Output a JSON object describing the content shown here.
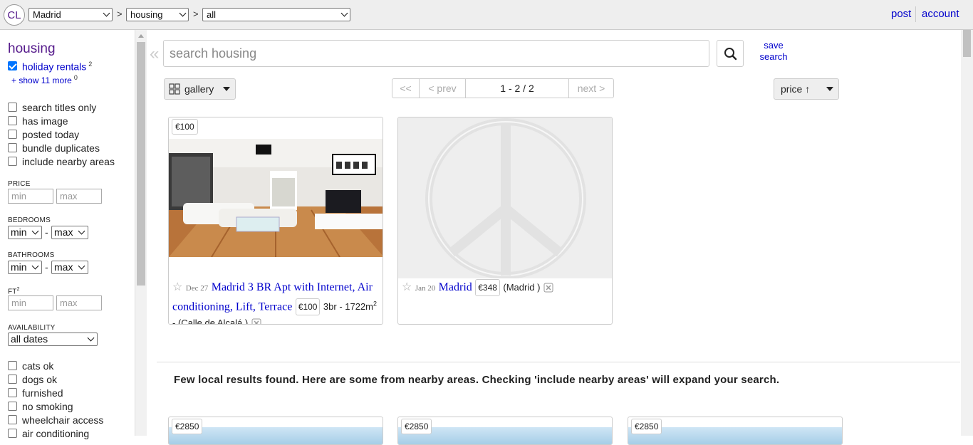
{
  "header": {
    "logo_text": "CL",
    "city_select": "Madrid",
    "crumb_sep": ">",
    "category_select": "housing",
    "subcategory_select": "all",
    "post_link": "post",
    "account_link": "account"
  },
  "sidebar": {
    "title": "housing",
    "category": {
      "label": "holiday rentals",
      "count": "2",
      "checked": true
    },
    "show_more": {
      "label": "show 11 more",
      "count": "0"
    },
    "search_options": [
      "search titles only",
      "has image",
      "posted today",
      "bundle duplicates",
      "include nearby areas"
    ],
    "price_label": "PRICE",
    "min_placeholder": "min",
    "max_placeholder": "max",
    "bedrooms_label": "BEDROOMS",
    "bathrooms_label": "BATHROOMS",
    "range_min": "min",
    "range_max": "max",
    "range_dash": "-",
    "ft_label": "FT",
    "ft_sup": "2",
    "availability_label": "AVAILABILITY",
    "availability_value": "all dates",
    "amenities": [
      "cats ok",
      "dogs ok",
      "furnished",
      "no smoking",
      "wheelchair access",
      "air conditioning"
    ]
  },
  "search": {
    "collapse_glyph": "«",
    "placeholder": "search housing",
    "save_label_1": "save",
    "save_label_2": "search"
  },
  "toolbar": {
    "view_label": "gallery",
    "pager_first": "<<",
    "pager_prev": "< prev",
    "pager_range": "1 - 2 / 2",
    "pager_next": "next >",
    "sort_label": "price ↑"
  },
  "listings": [
    {
      "price": "€100",
      "date": "Dec 27",
      "title": "Madrid 3 BR Apt with Internet, Air conditioning, Lift, Terrace",
      "inline_price": "€100",
      "details": "3br - 1722m",
      "details_sup": "2",
      "location": "- (Calle de Alcalá )"
    },
    {
      "date": "Jan 20",
      "title": "Madrid",
      "inline_price": "€348",
      "location": "(Madrid )"
    }
  ],
  "nearby_note": "Few local results found. Here are some from nearby areas. Checking 'include nearby areas' will expand your search.",
  "nearby_prices": [
    "€2850",
    "€2850",
    "€2850"
  ]
}
